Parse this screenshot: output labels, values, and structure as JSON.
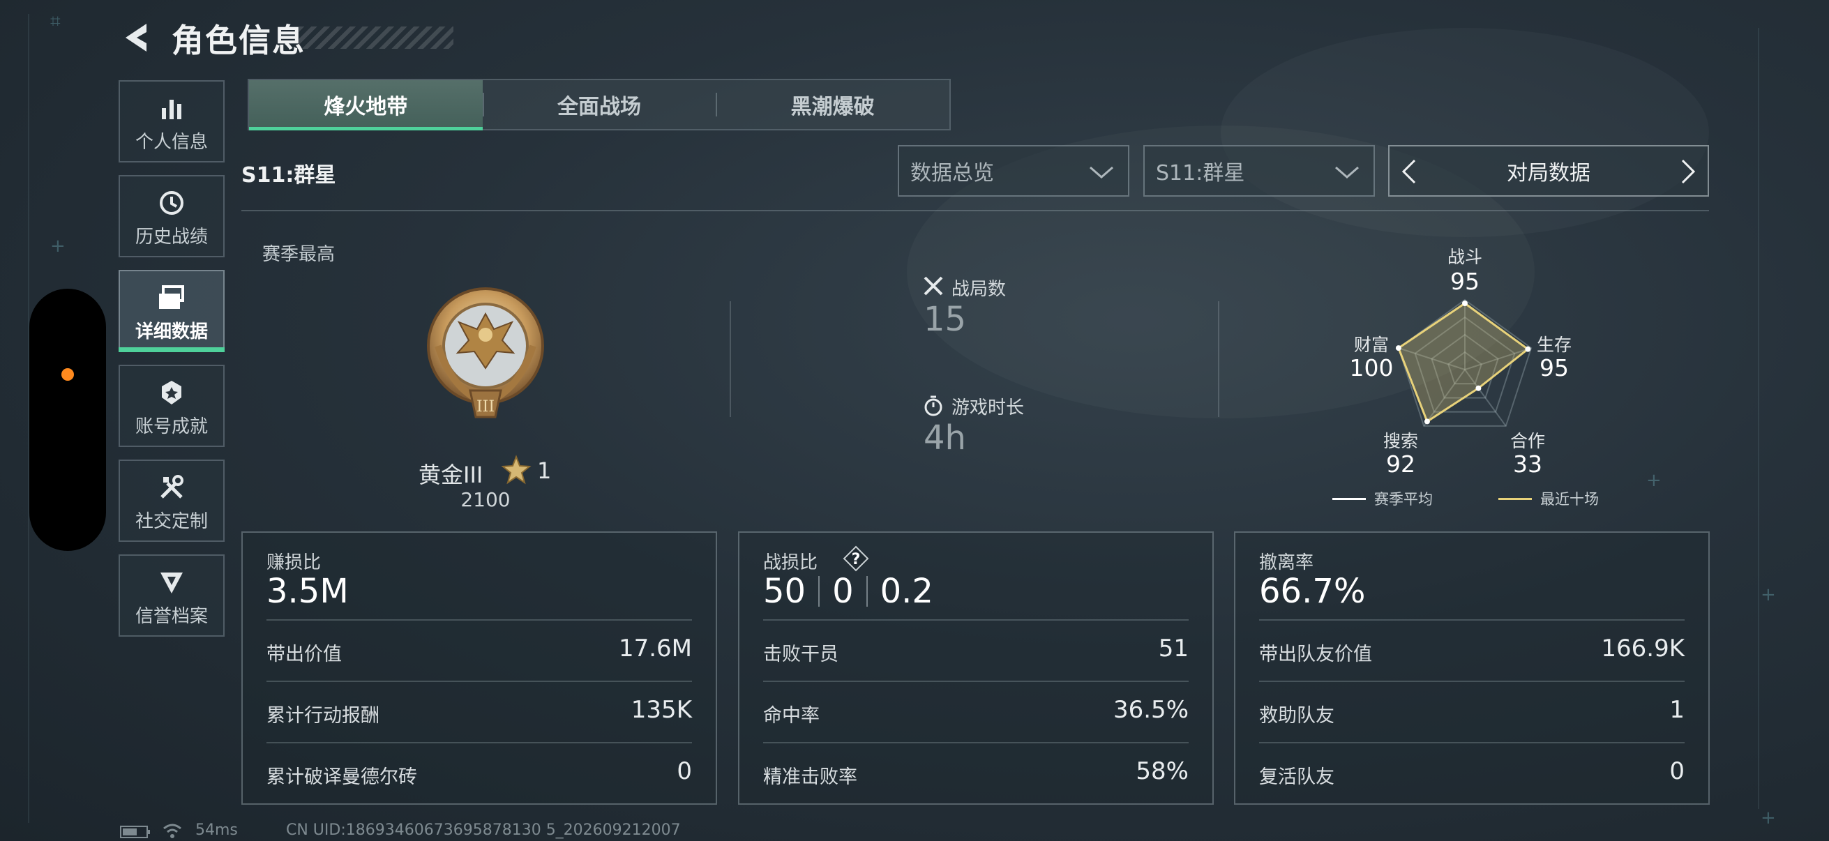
{
  "header": {
    "title": "角色信息"
  },
  "sidebar": {
    "items": [
      {
        "label": "个人信息",
        "icon": "bar-chart-icon",
        "active": false
      },
      {
        "label": "历史战绩",
        "icon": "history-clock-icon",
        "active": false
      },
      {
        "label": "详细数据",
        "icon": "cards-stack-icon",
        "active": true
      },
      {
        "label": "账号成就",
        "icon": "achievement-badge-icon",
        "active": false
      },
      {
        "label": "社交定制",
        "icon": "tools-icon",
        "active": false
      },
      {
        "label": "信誉档案",
        "icon": "credit-shield-icon",
        "active": false
      }
    ]
  },
  "tabs": [
    {
      "label": "烽火地带",
      "active": true
    },
    {
      "label": "全面战场",
      "active": false
    },
    {
      "label": "黑潮爆破",
      "active": false
    }
  ],
  "season_title": "S11:群星",
  "filters": {
    "view": "数据总览",
    "season": "S11:群星",
    "pager_label": "对局数据"
  },
  "rank": {
    "section_label": "赛季最高",
    "name": "黄金III",
    "stars": "1",
    "score": "2100"
  },
  "overview": {
    "matches_label": "战局数",
    "matches_value": "15",
    "playtime_label": "游戏时长",
    "playtime_value": "4h"
  },
  "radar": {
    "axes": [
      {
        "label": "战斗",
        "value": "95",
        "score": 95
      },
      {
        "label": "生存",
        "value": "95",
        "score": 95
      },
      {
        "label": "合作",
        "value": "33",
        "score": 33
      },
      {
        "label": "搜索",
        "value": "92",
        "score": 92
      },
      {
        "label": "财富",
        "value": "100",
        "score": 100
      }
    ],
    "legend": [
      {
        "label": "赛季平均",
        "color": "#ffffff"
      },
      {
        "label": "最近十场",
        "color": "#e8d27a"
      }
    ],
    "colors": {
      "recent": "#e8d27a",
      "average": "#ffffff"
    }
  },
  "cards": [
    {
      "header_label": "赚损比",
      "header_value": "3.5M",
      "rows": [
        {
          "label": "带出价值",
          "value": "17.6M"
        },
        {
          "label": "累计行动报酬",
          "value": "135K"
        },
        {
          "label": "累计破译曼德尔砖",
          "value": "0"
        }
      ]
    },
    {
      "header_label": "战损比",
      "header_values": [
        "50",
        "0",
        "0.2"
      ],
      "help": "?",
      "rows": [
        {
          "label": "击败干员",
          "value": "51"
        },
        {
          "label": "命中率",
          "value": "36.5%"
        },
        {
          "label": "精准击败率",
          "value": "58%"
        }
      ]
    },
    {
      "header_label": "撤离率",
      "header_value": "66.7%",
      "rows": [
        {
          "label": "带出队友价值",
          "value": "166.9K"
        },
        {
          "label": "救助队友",
          "value": "1"
        },
        {
          "label": "复活队友",
          "value": "0"
        }
      ]
    }
  ],
  "status_bar": {
    "ping": "54ms",
    "uid": "CN UID:18693460673695878130 5_202609212007"
  },
  "accent_color": "#4fd19b"
}
